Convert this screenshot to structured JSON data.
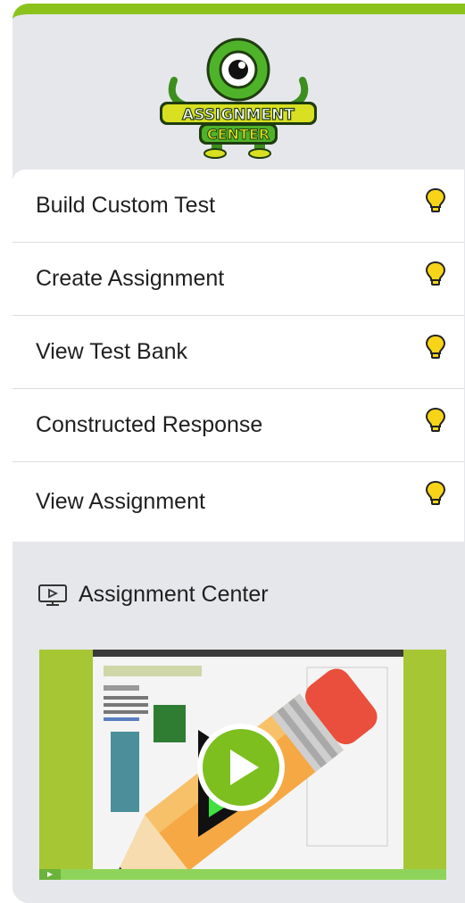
{
  "logo": {
    "line1": "ASSIGNMENT",
    "line2": "CENTER"
  },
  "menu": {
    "items": [
      {
        "label": "Build Custom Test",
        "icon": "lightbulb-icon"
      },
      {
        "label": "Create Assignment",
        "icon": "lightbulb-icon"
      },
      {
        "label": "View Test Bank",
        "icon": "lightbulb-icon"
      },
      {
        "label": "Constructed Response",
        "icon": "lightbulb-icon"
      },
      {
        "label": "View Assignment",
        "icon": "lightbulb-icon"
      }
    ]
  },
  "video": {
    "icon": "video-screen-icon",
    "title": "Assignment Center",
    "play_icon": "play-button-icon"
  },
  "colors": {
    "accent": "#8bc31c",
    "panel_bg": "#e6e7eb",
    "bulb_yellow": "#f7d417",
    "play_green": "#7cbf1e"
  }
}
